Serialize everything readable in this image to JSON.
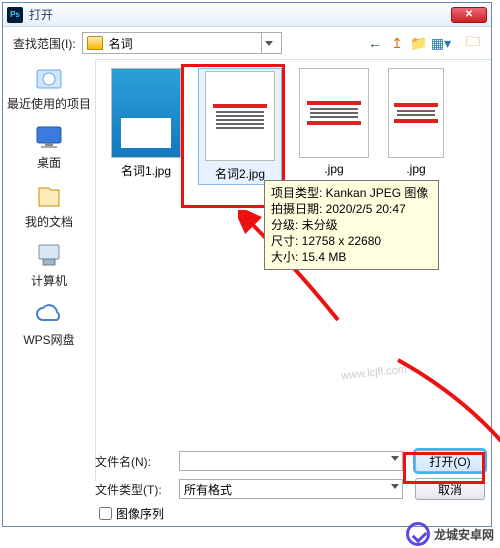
{
  "window": {
    "title": "打开"
  },
  "toolbar": {
    "look_in_label": "查找范围(I):",
    "current_folder": "名词"
  },
  "sidebar": {
    "items": [
      {
        "label": "最近使用的项目"
      },
      {
        "label": "桌面"
      },
      {
        "label": "我的文档"
      },
      {
        "label": "计算机"
      },
      {
        "label": "WPS网盘"
      }
    ]
  },
  "files": [
    {
      "name": "名词1.jpg"
    },
    {
      "name": "名词2.jpg"
    },
    {
      "name": "",
      "partial": ".jpg"
    }
  ],
  "tooltip": {
    "line1": "项目类型: Kankan JPEG 图像",
    "line2": "拍摄日期: 2020/2/5 20:47",
    "line3": "分级: 未分级",
    "line4": "尺寸: 12758 x 22680",
    "line5": "大小: 15.4 MB"
  },
  "bottom": {
    "filename_label": "文件名(N):",
    "filetype_label": "文件类型(T):",
    "filetype_value": "所有格式",
    "open_label": "打开(O)",
    "cancel_label": "取消",
    "checkbox_label": "图像序列"
  },
  "watermark": {
    "text": "龙城安卓网",
    "small": "www.lcjfl.com"
  }
}
